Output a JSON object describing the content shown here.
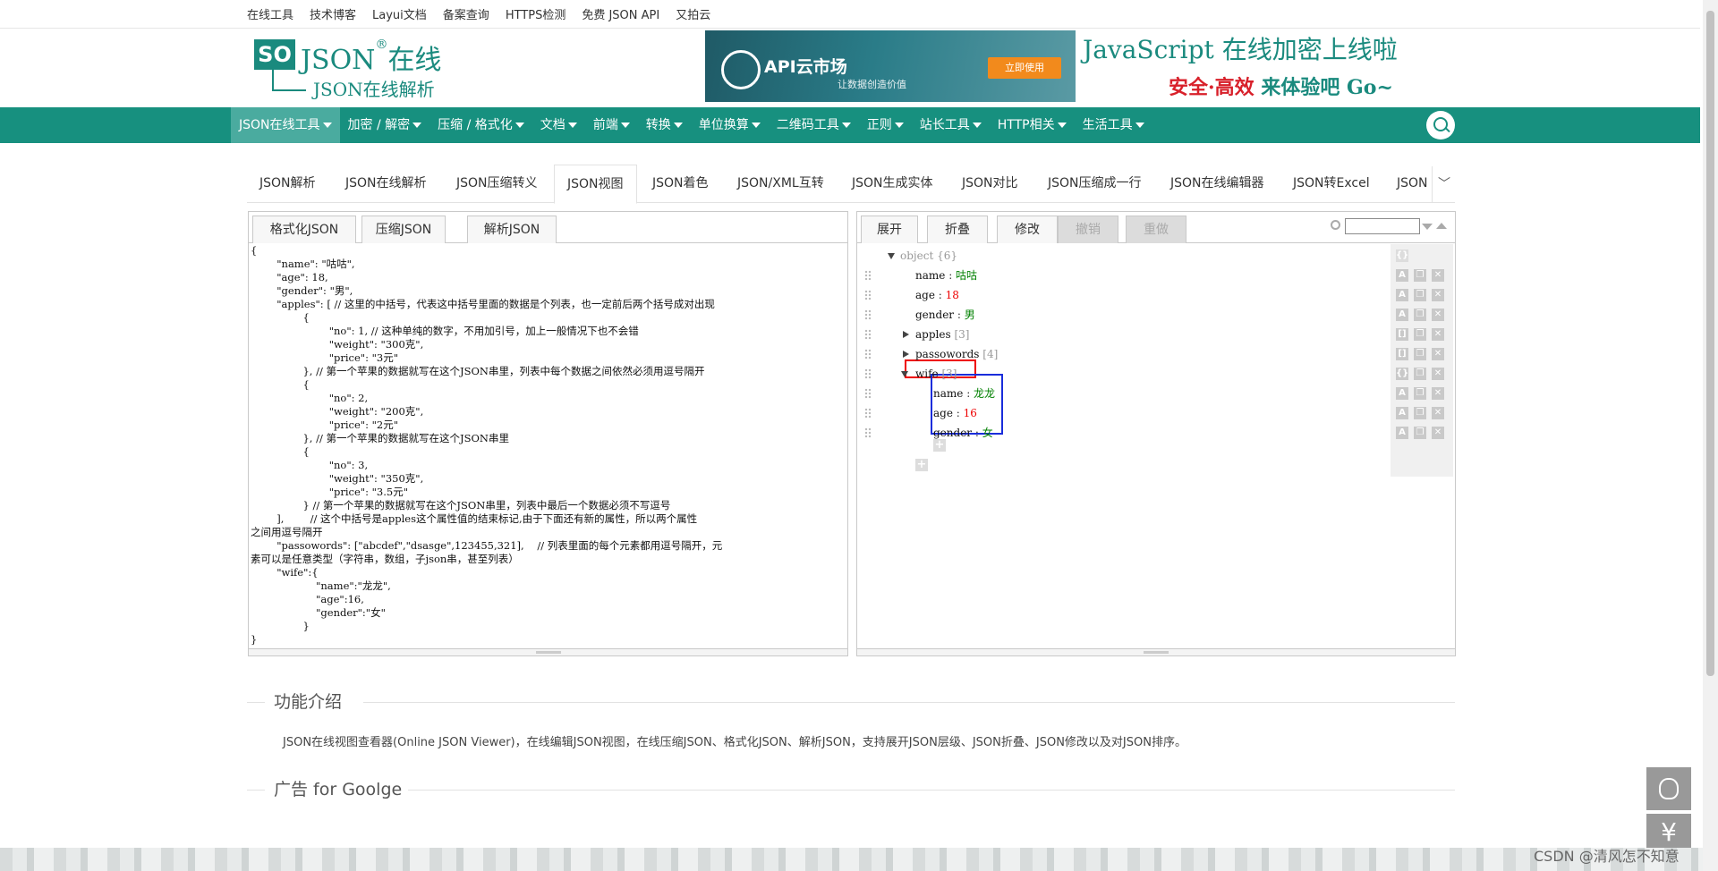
{
  "top_links": [
    "在线工具",
    "技术博客",
    "Layui文档",
    "备案查询",
    "HTTPS检测",
    "免费 JSON API",
    "又拍云"
  ],
  "logo": {
    "mark": "SO",
    "main": "JSON",
    "reg": "®",
    "suffix": "在线",
    "sub": "JSON在线解析"
  },
  "banner_api": {
    "title": "API云市场",
    "sub": "让数据创造价值",
    "button": "立即使用"
  },
  "banner_js": {
    "line1": "JavaScript 在线加密上线啦",
    "line2_a": "安全·高效",
    "line2_b": " 来体验吧 Go~"
  },
  "nav": [
    "JSON在线工具",
    "加密 / 解密",
    "压缩 / 格式化",
    "文档",
    "前端",
    "转换",
    "单位换算",
    "二维码工具",
    "正则",
    "站长工具",
    "HTTP相关",
    "生活工具"
  ],
  "tabs": [
    "JSON解析",
    "JSON在线解析",
    "JSON压缩转义",
    "JSON视图",
    "JSON着色",
    "JSON/XML互转",
    "JSON生成实体",
    "JSON对比",
    "JSON压缩成一行",
    "JSON在线编辑器",
    "JSON转Excel",
    "JSON"
  ],
  "tabs_more": "﹀",
  "left_tabs": [
    "格式化JSON",
    "压缩JSON",
    "解析JSON"
  ],
  "right_tabs": [
    "展开",
    "折叠",
    "修改",
    "撤销",
    "重做"
  ],
  "code_lines": [
    "{",
    "        \"name\": \"咕咕\",",
    "        \"age\": 18,",
    "        \"gender\": \"男\",",
    "        \"apples\": [ // 这里的中括号，代表这中括号里面的数据是个列表，也一定前后两个括号成对出现",
    "                {",
    "                        \"no\": 1, // 这种单纯的数字，不用加引号，加上一般情况下也不会错",
    "                        \"weight\": \"300克\",",
    "                        \"price\": \"3元\"",
    "                }, // 第一个苹果的数据就写在这个JSON串里，列表中每个数据之间依然必须用逗号隔开",
    "                {",
    "                        \"no\": 2,",
    "                        \"weight\": \"200克\",",
    "                        \"price\": \"2元\"",
    "                }, // 第一个苹果的数据就写在这个JSON串里",
    "                {",
    "                        \"no\": 3,",
    "                        \"weight\": \"350克\",",
    "                        \"price\": \"3.5元\"",
    "                } // 第一个苹果的数据就写在这个JSON串里，列表中最后一个数据必须不写逗号",
    "        ],        // 这个中括号是apples这个属性值的结束标记,由于下面还有新的属性，所以两个属性",
    "之间用逗号隔开",
    "        \"passowords\": [\"abcdef\",\"dsasge\",123455,321],    // 列表里面的每个元素都用逗号隔开，元",
    "素可以是任意类型（字符串，数组，子json串，甚至列表）",
    "        \"wife\":{",
    "                    \"name\":\"龙龙\",",
    "                    \"age\":16,",
    "                    \"gender\":\"女\"",
    "                }",
    "}"
  ],
  "tree": {
    "root": {
      "key": "object",
      "meta": "{6}"
    },
    "rows": [
      {
        "key": "name",
        "sep": " : ",
        "value": "咕咕",
        "type": "str"
      },
      {
        "key": "age",
        "sep": " : ",
        "value": "18",
        "type": "num"
      },
      {
        "key": "gender",
        "sep": " : ",
        "value": "男",
        "type": "str"
      },
      {
        "key": "apples",
        "meta": " [3]"
      },
      {
        "key": "passowords",
        "meta": " [4]"
      },
      {
        "key": "wife",
        "meta": " [3]"
      },
      {
        "key": "name",
        "sep": " : ",
        "value": "龙龙",
        "type": "str"
      },
      {
        "key": "age",
        "sep": " : ",
        "value": "16",
        "type": "num"
      },
      {
        "key": "gender",
        "sep": " : ",
        "value": "女",
        "type": "str"
      }
    ]
  },
  "section_intro": {
    "title": "功能介绍",
    "text": "JSON在线视图查看器(Online JSON Viewer)，在线编辑JSON视图，在线压缩JSON、格式化JSON、解析JSON，支持展开JSON层级、JSON折叠、JSON修改以及对JSON排序。"
  },
  "section_ad": {
    "title": "广告 for Goolge"
  },
  "float": {
    "yen": "¥"
  },
  "watermark": "CSDN @清风怎不知意",
  "colors": {
    "brand": "#17907f",
    "red_box": "#e00000",
    "blue_box": "#1a2ddb"
  }
}
